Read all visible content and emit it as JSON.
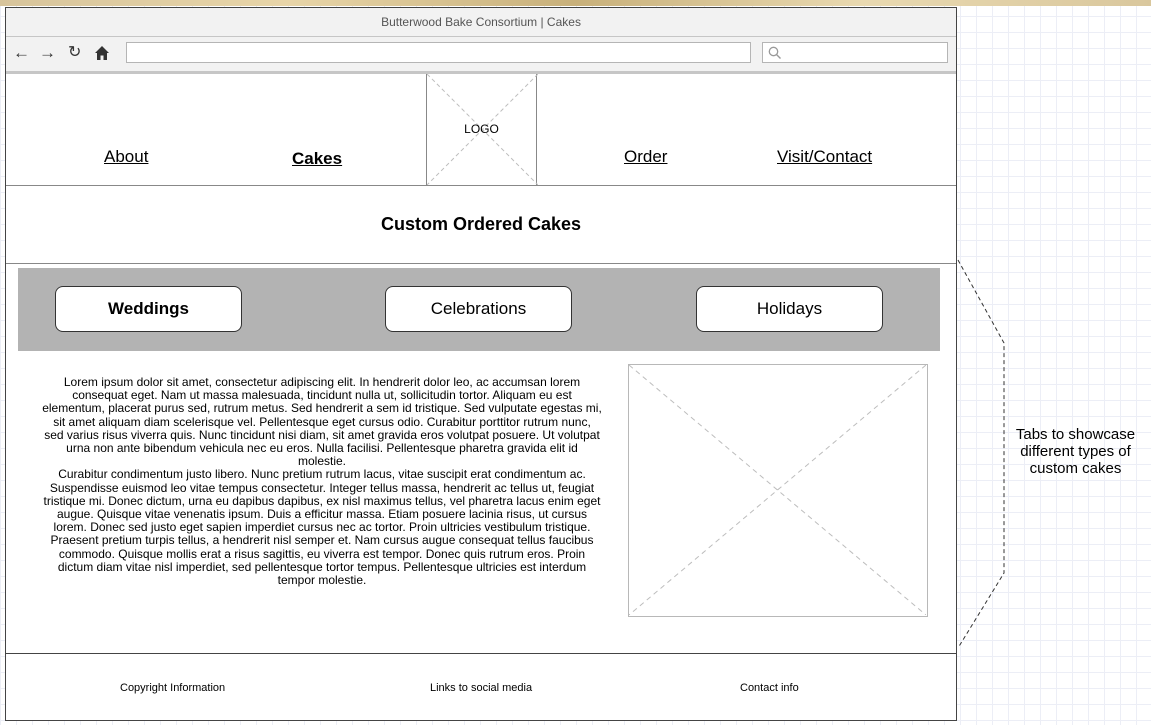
{
  "window": {
    "title": "Butterwood Bake Consortium | Cakes"
  },
  "browser": {
    "nav_icons": [
      "back-arrow-icon",
      "forward-arrow-icon",
      "reload-icon",
      "home-icon"
    ],
    "url_value": "",
    "search_icon": "search-icon"
  },
  "nav": {
    "about": "About",
    "cakes": "Cakes",
    "logo": "LOGO",
    "order": "Order",
    "visit": "Visit/Contact",
    "active": "Cakes"
  },
  "page": {
    "title": "Custom Ordered Cakes"
  },
  "tabs": {
    "items": [
      "Weddings",
      "Celebrations",
      "Holidays"
    ],
    "active": "Weddings",
    "panel_color": "#b3b3b3"
  },
  "content": {
    "paragraph1": "Lorem ipsum dolor sit amet, consectetur adipiscing elit. In hendrerit dolor leo, ac accumsan lorem consequat eget. Nam ut massa malesuada, tincidunt nulla ut, sollicitudin tortor. Aliquam eu est elementum, placerat purus sed, rutrum metus. Sed hendrerit a sem id tristique. Sed vulputate egestas mi, sit amet aliquam diam scelerisque vel. Pellentesque eget cursus odio. Curabitur porttitor rutrum nunc, sed varius risus viverra quis. Nunc tincidunt nisi diam, sit amet gravida eros volutpat posuere. Ut volutpat urna non ante bibendum vehicula nec eu eros. Nulla facilisi. Pellentesque pharetra gravida elit id molestie.",
    "paragraph2": "Curabitur condimentum justo libero. Nunc pretium rutrum lacus, vitae suscipit erat condimentum ac. Suspendisse euismod leo vitae tempus consectetur. Integer tellus massa, hendrerit ac tellus ut, feugiat tristique mi. Donec dictum, urna eu dapibus dapibus, ex nisl maximus tellus, vel pharetra lacus enim eget augue. Quisque vitae venenatis ipsum. Duis a efficitur massa. Etiam posuere lacinia risus, ut cursus lorem. Donec sed justo eget sapien imperdiet cursus nec ac tortor. Proin ultricies vestibulum tristique. Praesent pretium turpis tellus, a hendrerit nisl semper et. Nam cursus augue consequat tellus faucibus commodo. Quisque mollis erat a risus sagittis, eu viverra est tempor. Donec quis rutrum eros. Proin dictum diam vitae nisl imperdiet, sed pellentesque tortor tempus. Pellentesque ultricies est interdum tempor molestie."
  },
  "footer": {
    "copyright": "Copyright Information",
    "social": "Links to social media",
    "contact": "Contact info"
  },
  "annotation": {
    "text": "Tabs to showcase different types of custom cakes"
  }
}
